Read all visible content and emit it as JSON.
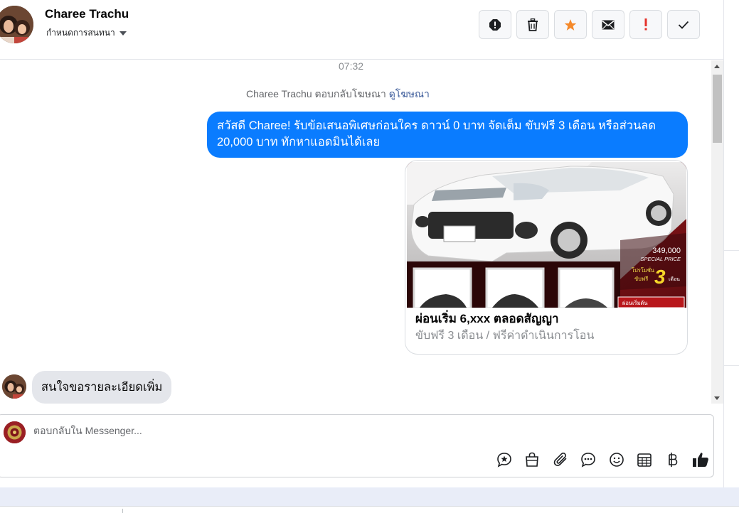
{
  "header": {
    "contact_name": "Charee Trachu",
    "assign_label": "กำหนดการสนทนา",
    "toolbar": [
      {
        "name": "spam-alert-button",
        "icon": "alert-circle-icon"
      },
      {
        "name": "delete-button",
        "icon": "trash-icon"
      },
      {
        "name": "star-button",
        "icon": "star-icon"
      },
      {
        "name": "mark-unread-button",
        "icon": "envelope-icon"
      },
      {
        "name": "important-button",
        "icon": "exclamation-icon"
      },
      {
        "name": "mark-done-button",
        "icon": "check-icon"
      }
    ]
  },
  "thread": {
    "timestamp": "07:32",
    "ad_note": {
      "text": "Charee Trachu ตอบกลับโฆษณา",
      "link": "ดูโฆษณา"
    },
    "outgoing_message": "สวัสดี Charee! รับข้อเสนอพิเศษก่อนใคร ดาวน์ 0 บาท จัดเต็ม ขับฟรี 3 เดือน หรือส่วนลด 20,000 บาท ทักหาแอดมินได้เลย",
    "ad_card": {
      "title": "ผ่อนเริ่ม 6,xxx ตลอดสัญญา",
      "subtitle": "ขับฟรี 3 เดือน / ฟรีค่าดำเนินการโอน",
      "image_text": {
        "price": "349,000",
        "special": "SPECIAL PRICE",
        "promo": "โปรโมชั่น",
        "free": "ขับฟรี",
        "months_number": "3",
        "months_word": "เดือน",
        "start": "ผ่อนเริ่มต้น"
      }
    },
    "incoming_message": "สนใจขอรายละเอียดเพิ่ม"
  },
  "composer": {
    "placeholder": "ตอบกลับใน Messenger...",
    "icons": [
      "saved-reply-icon",
      "shopping-bag-icon",
      "paperclip-icon",
      "chat-bubbles-icon",
      "emoji-icon",
      "calendar-icon",
      "baht-icon",
      "thumbs-up-icon"
    ]
  },
  "colors": {
    "outgoing_bubble": "#0a7cff",
    "incoming_bubble": "#e4e6eb",
    "star": "#f5892a",
    "important": "#e4322b",
    "link": "#385898"
  }
}
